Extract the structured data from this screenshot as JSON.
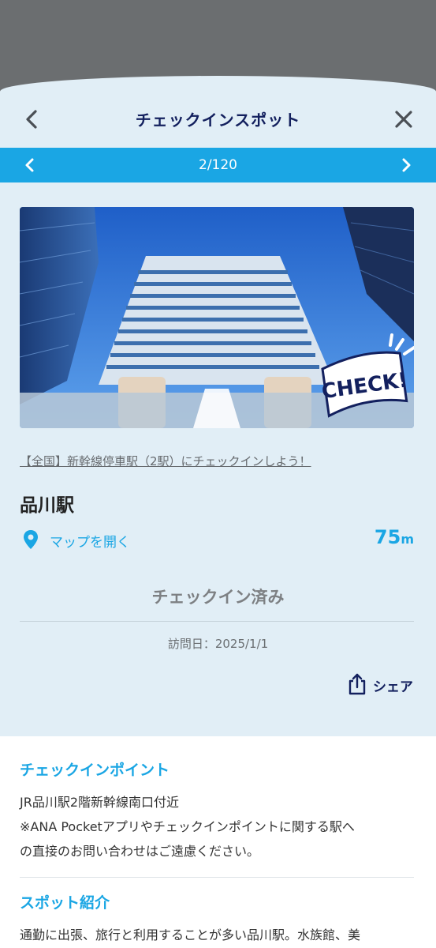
{
  "header": {
    "title": "チェックインスポット"
  },
  "pager": {
    "count": "2/120"
  },
  "photo": {
    "badge": "CHECK!"
  },
  "spot": {
    "campaign_link": "【全国】新幹線停車駅（2駅）にチェックインしよう！",
    "name": "品川駅",
    "map_link": "マップを開く",
    "distance_value": "75",
    "distance_unit": "m",
    "status": "チェックイン済み",
    "visit_date": "訪問日：2025/1/1",
    "share_label": "シェア"
  },
  "checkin_point": {
    "heading": "チェックインポイント",
    "line1": "JR品川駅2階新幹線南口付近",
    "line2": "※ANA Pocketアプリやチェックインポイントに関する駅へ",
    "line3": "の直接のお問い合わせはご遠慮ください。"
  },
  "spot_intro": {
    "heading": "スポット紹介",
    "text": "通勤に出張、旅行と利用することが多い品川駅。水族館、美"
  },
  "colors": {
    "accent": "#1aa6e4",
    "navy": "#13205e",
    "sheet_bg": "#e1eef6"
  }
}
